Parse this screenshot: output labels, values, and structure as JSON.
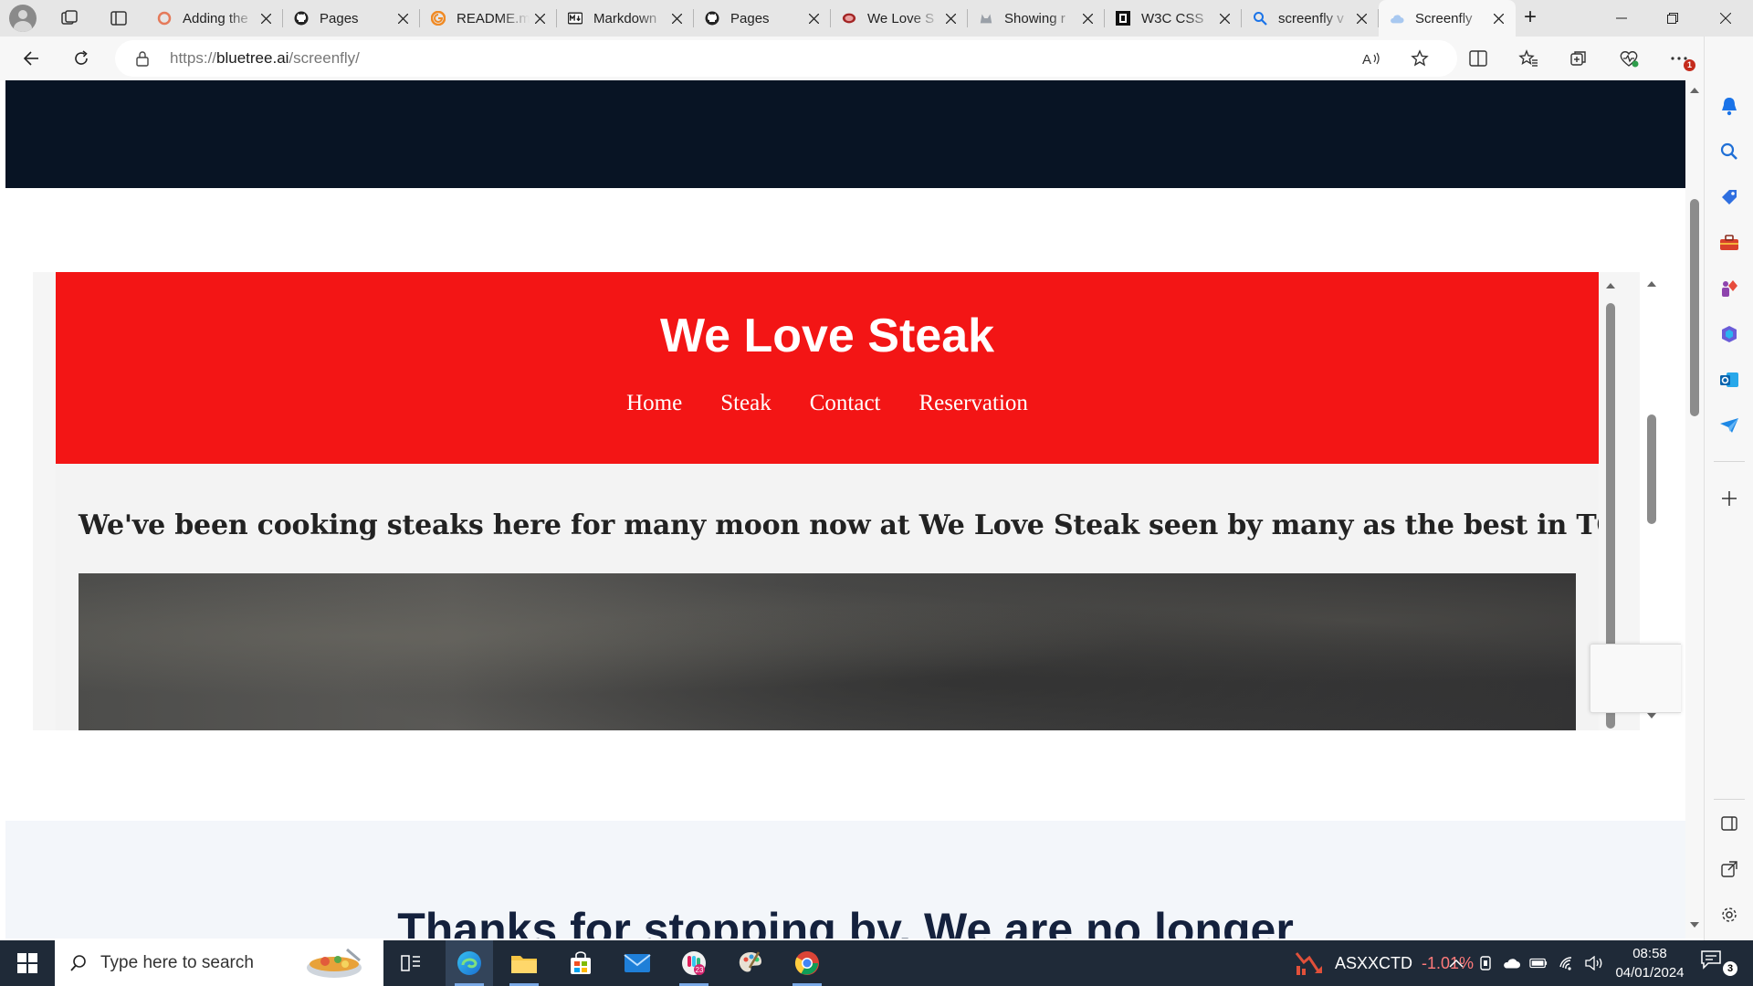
{
  "browser": {
    "tabs": [
      {
        "title": "Adding the",
        "favicon": "circle-ring-icon",
        "active": false
      },
      {
        "title": "Pages",
        "favicon": "github-icon",
        "active": false
      },
      {
        "title": "README.m",
        "favicon": "gitbook-icon",
        "active": false
      },
      {
        "title": "Markdown",
        "favicon": "markdown-icon",
        "active": false
      },
      {
        "title": "Pages",
        "favicon": "github-icon",
        "active": false
      },
      {
        "title": "We Love S",
        "favicon": "steak-icon",
        "active": false
      },
      {
        "title": "Showing r",
        "favicon": "animal-icon",
        "active": false
      },
      {
        "title": "W3C CSS",
        "favicon": "w3c-icon",
        "active": false
      },
      {
        "title": "screenfly v",
        "favicon": "search-icon",
        "active": false
      },
      {
        "title": "Screenfly",
        "favicon": "cloud-icon",
        "active": true
      }
    ],
    "address": {
      "scheme": "https://",
      "host": "bluetree.ai",
      "path": "/screenfly/"
    },
    "colors": {
      "accent": "#0f6cbd",
      "notification_badge": "#c42b1c"
    }
  },
  "page": {
    "preview": {
      "site_title": "We Love Steak",
      "nav": [
        "Home",
        "Steak",
        "Contact",
        "Reservation"
      ],
      "tagline": "We've been cooking steaks here for many moon now at We Love Steak seen by many as the best in TOWN!",
      "header_color": "#f31515"
    },
    "thanks_heading": "Thanks for stopping by. We are no longer"
  },
  "taskbar": {
    "search_placeholder": "Type here to search",
    "stock": {
      "symbol": "ASXXCTD",
      "change": "-1.01%"
    },
    "clock": {
      "time": "08:58",
      "date": "04/01/2024"
    },
    "calendar_badge": "23",
    "notification_count": "3"
  }
}
